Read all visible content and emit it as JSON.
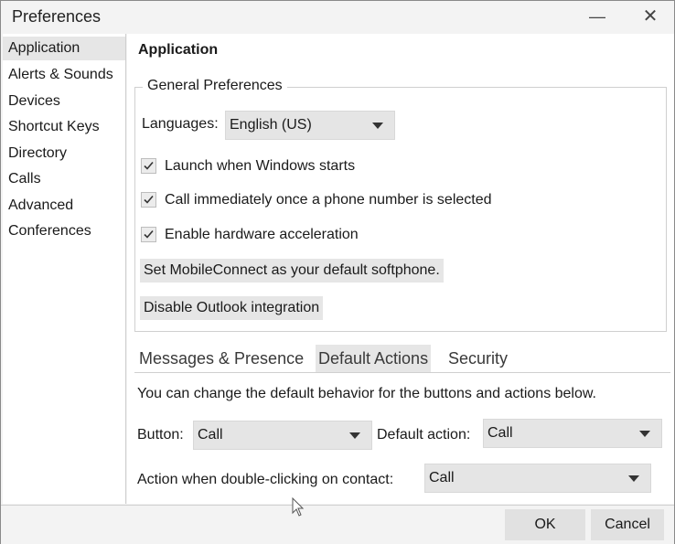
{
  "window": {
    "title": "Preferences",
    "minimize_glyph": "—",
    "close_glyph": "✕"
  },
  "sidebar": {
    "items": [
      {
        "label": "Application",
        "selected": true
      },
      {
        "label": "Alerts & Sounds"
      },
      {
        "label": "Devices"
      },
      {
        "label": "Shortcut Keys"
      },
      {
        "label": "Directory"
      },
      {
        "label": "Calls"
      },
      {
        "label": "Advanced"
      },
      {
        "label": "Conferences"
      }
    ]
  },
  "main": {
    "heading": "Application",
    "general": {
      "title": "General Preferences",
      "languages_label": "Languages:",
      "language_value": "English (US)",
      "checkboxes": [
        {
          "label": "Launch when Windows starts",
          "checked": true
        },
        {
          "label": "Call immediately once a phone number is selected",
          "checked": true
        },
        {
          "label": "Enable hardware acceleration",
          "checked": true
        }
      ],
      "softphone_button": "Set MobileConnect as your default softphone.",
      "outlook_button": "Disable Outlook integration"
    },
    "tabs": [
      {
        "label": "Messages & Presence"
      },
      {
        "label": "Default Actions",
        "active": true
      },
      {
        "label": "Security"
      }
    ],
    "default_actions": {
      "description": "You can change the default behavior for the buttons and actions below.",
      "button_label": "Button:",
      "button_value": "Call",
      "default_action_label": "Default action:",
      "default_action_value": "Call",
      "double_click_label": "Action when double-clicking on contact:",
      "double_click_value": "Call"
    }
  },
  "footer": {
    "ok_label": "OK",
    "cancel_label": "Cancel"
  },
  "icons": {
    "check": "check-icon",
    "dropdown": "chevron-down-icon",
    "cursor": "mouse-pointer-icon"
  }
}
